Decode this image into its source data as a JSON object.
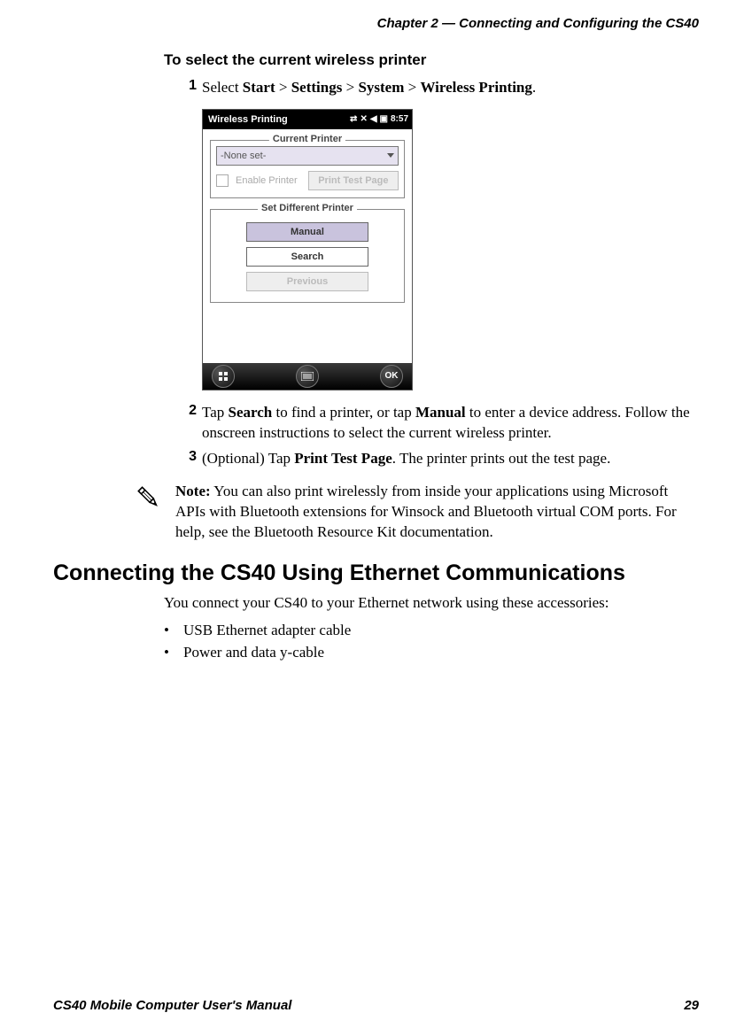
{
  "header": {
    "chapter": "Chapter 2 — Connecting and Configuring the CS40"
  },
  "footer": {
    "manual": "CS40 Mobile Computer User's Manual",
    "page": "29"
  },
  "subheading": "To select the current wireless printer",
  "steps": {
    "s1_num": "1",
    "s1_a": "Select ",
    "s1_start": "Start",
    "s1_sep1": " > ",
    "s1_settings": "Settings",
    "s1_sep2": " > ",
    "s1_system": "System",
    "s1_sep3": " > ",
    "s1_wp": "Wireless Printing",
    "s1_end": ".",
    "s2_num": "2",
    "s2_a": "Tap ",
    "s2_search": "Search",
    "s2_b": " to find a printer, or tap ",
    "s2_manual": "Manual",
    "s2_c": " to enter a device address. Follow the onscreen instructions to select the current wireless printer.",
    "s3_num": "3",
    "s3_a": "(Optional) Tap ",
    "s3_ptp": "Print Test Page",
    "s3_b": ". The printer prints out the test page."
  },
  "screenshot": {
    "title": "Wireless Printing",
    "time": "8:57",
    "current_printer_legend": "Current Printer",
    "none_set": "-None set-",
    "enable_printer": "Enable Printer",
    "print_test_page": "Print Test Page",
    "set_diff_legend": "Set Different Printer",
    "manual": "Manual",
    "search": "Search",
    "previous": "Previous",
    "ok": "OK"
  },
  "note": {
    "label": "Note:",
    "text": " You can also print wirelessly from inside your applications using Microsoft APIs with Bluetooth extensions for Winsock and Bluetooth virtual COM ports. For help, see the Bluetooth Resource Kit documentation."
  },
  "section_heading": "Connecting the CS40 Using Ethernet Communications",
  "section_para": "You connect your CS40 to your Ethernet network using these accessories:",
  "bullets": {
    "b1": "USB Ethernet adapter cable",
    "b2": "Power and data y-cable"
  }
}
